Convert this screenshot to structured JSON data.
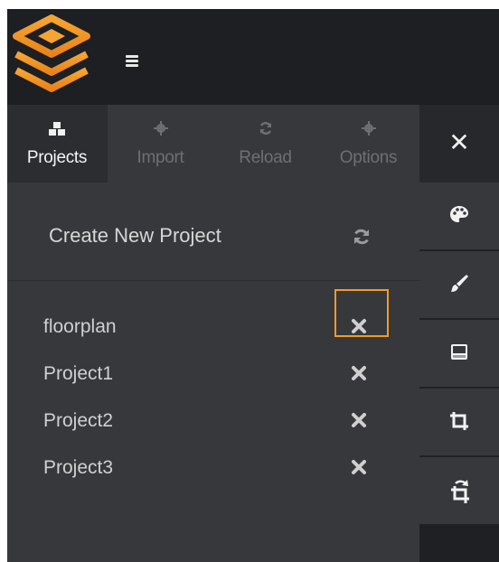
{
  "topbar": {
    "menu_icon": "hamburger-icon",
    "logo_icon": "stacked-layers-logo"
  },
  "tabs": [
    {
      "label": "Projects",
      "icon": "cubes-icon",
      "state": "active"
    },
    {
      "label": "Import",
      "icon": "gear-icon",
      "state": "disabled"
    },
    {
      "label": "Reload",
      "icon": "refresh-icon",
      "state": "disabled"
    },
    {
      "label": "Options",
      "icon": "gear-icon",
      "state": "disabled"
    }
  ],
  "close_label": "✕",
  "panel": {
    "create_label": "Create New Project",
    "create_icon": "refresh-icon",
    "projects": [
      {
        "name": "floorplan",
        "highlighted": true
      },
      {
        "name": "Project1"
      },
      {
        "name": "Project2"
      },
      {
        "name": "Project3"
      }
    ]
  },
  "toolbar": [
    "palette-icon",
    "brush-icon",
    "monitor-icon",
    "crop-icon",
    "crop-rotate-icon"
  ],
  "colors": {
    "accent": "#f29b2b",
    "topbar_bg": "#1e1f22",
    "panel_bg": "#36383c",
    "toolbar_bg": "#1f2023"
  }
}
